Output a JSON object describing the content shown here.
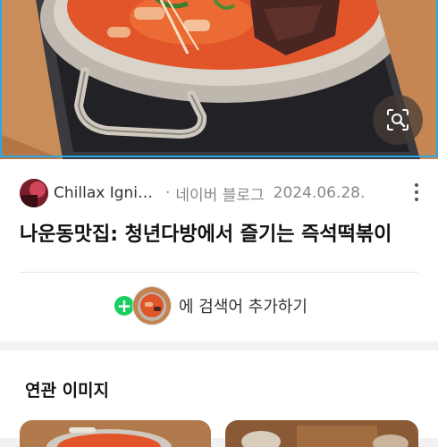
{
  "result": {
    "author": "Chillax Igni…",
    "separator": "·",
    "source": "네이버 블로그",
    "date": "2024.06.28.",
    "title": "나운동맛집: 청년다방에서 즐기는 즉석떡볶이"
  },
  "add_keyword": {
    "text": "에 검색어 추가하기"
  },
  "related": {
    "title": "연관 이미지"
  },
  "icons": {
    "lens": "lens-search-icon",
    "more": "more-vertical-icon",
    "plus": "plus-icon"
  },
  "colors": {
    "accent_green": "#19ce60",
    "frame_blue": "#2aa7e8"
  }
}
